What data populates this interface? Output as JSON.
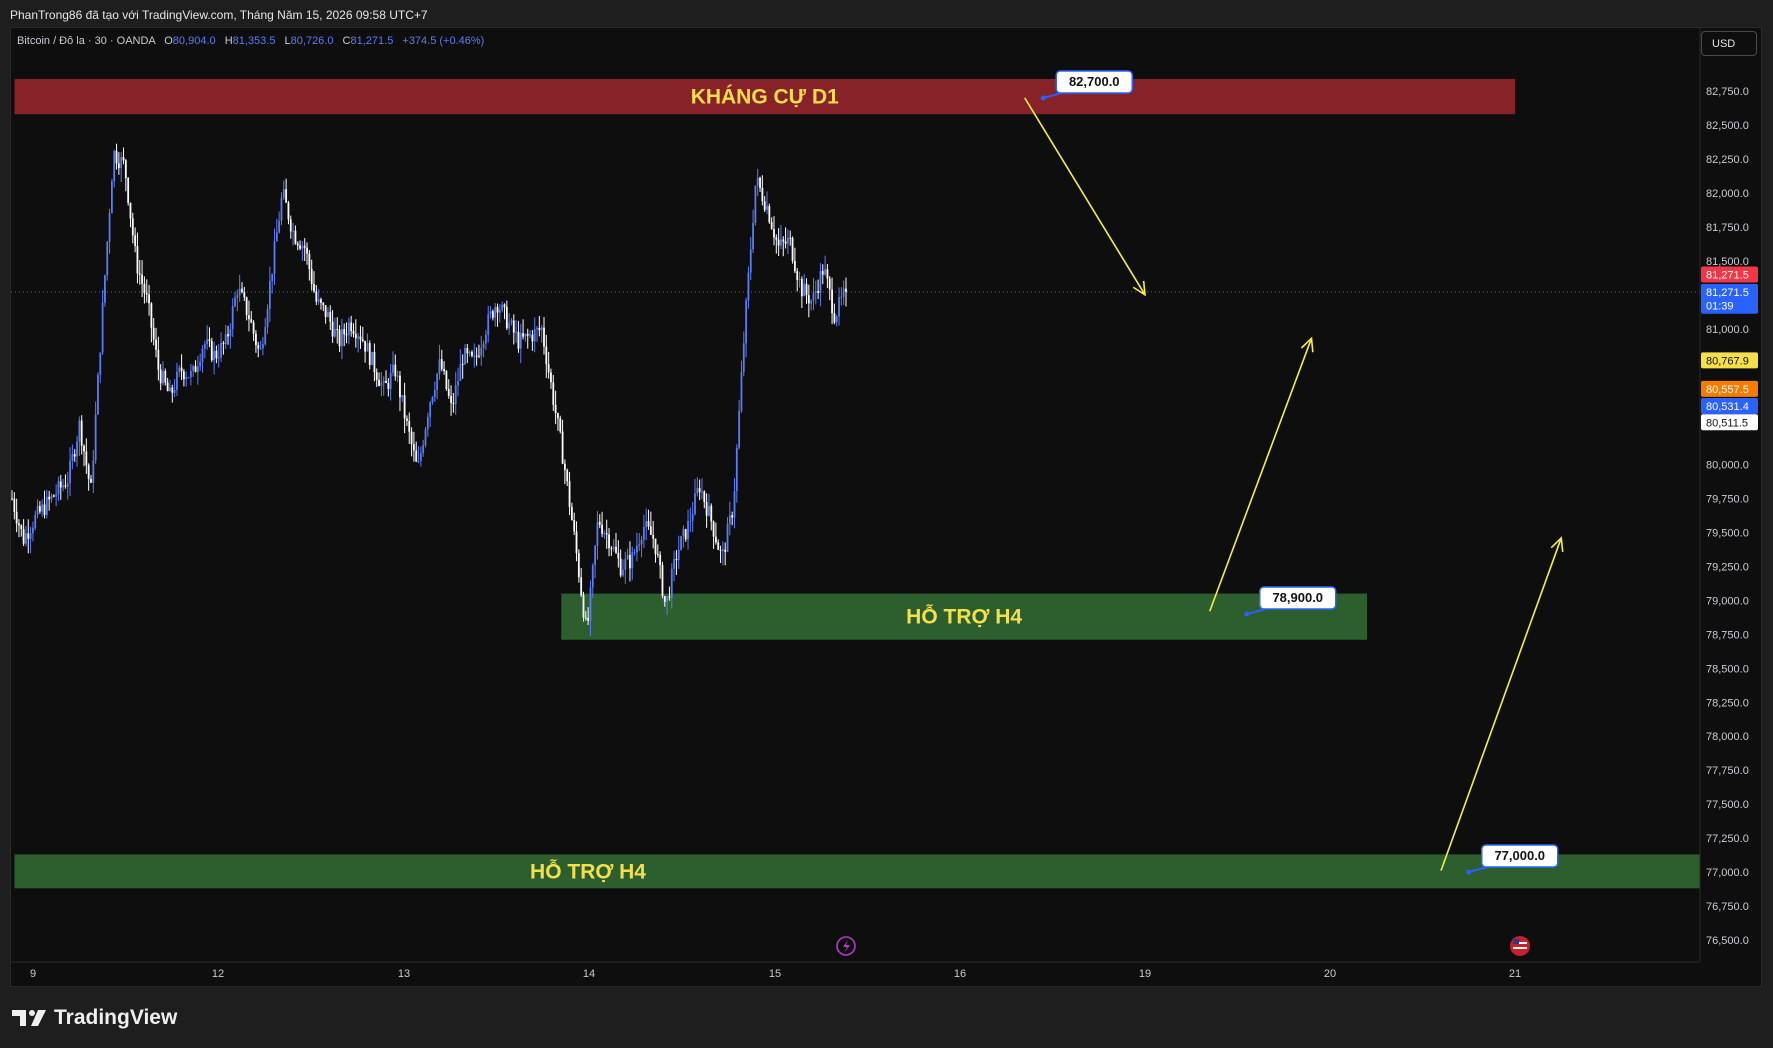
{
  "attribution": "PhanTrong86 đã tạo với TradingView.com, Tháng Năm 15, 2026 09:58 UTC+7",
  "legend": {
    "symbol": "Bitcoin / Đô la · 30 · OANDA",
    "o_label": "O",
    "o_value": "80,904.0",
    "h_label": "H",
    "h_value": "81,353.5",
    "l_label": "L",
    "l_value": "80,726.0",
    "c_label": "C",
    "c_value": "81,271.5",
    "change": "+374.5 (+0.46%)"
  },
  "currency_button": "USD",
  "logo_text": "TradingView",
  "colors": {
    "up": "#5b7cf7",
    "down": "#ffffff",
    "resistance": "#862228",
    "support": "#2c5e2e",
    "arrow": "#f4f047",
    "bg": "#0e0e0e"
  },
  "chart_data": {
    "type": "candlestick",
    "x_labels": [
      "9",
      "12",
      "13",
      "14",
      "15",
      "16",
      "19",
      "20",
      "21"
    ],
    "y_ticks": [
      "82,750.0",
      "82,500.0",
      "82,250.0",
      "82,000.0",
      "81,750.0",
      "81,500.0",
      "81,000.0",
      "80,000.0",
      "79,750.0",
      "79,500.0",
      "79,250.0",
      "79,000.0",
      "78,750.0",
      "78,500.0",
      "78,250.0",
      "78,000.0",
      "77,750.0",
      "77,500.0",
      "77,250.0",
      "77,000.0",
      "76,750.0",
      "76,500.0"
    ],
    "ylim": [
      76350,
      83250
    ],
    "price_tags": [
      {
        "text": "81,271.5",
        "price": 81400,
        "bg": "#f23645",
        "fg": "#ffffff"
      },
      {
        "text": "81,271.5",
        "price": 81271.5,
        "bg": "#2962ff",
        "fg": "#ffffff"
      },
      {
        "text": "01:39",
        "price": 81170,
        "bg": "#2962ff",
        "fg": "#ffffff"
      },
      {
        "text": "80,767.9",
        "price": 80767.9,
        "bg": "#f5e04a",
        "fg": "#111111"
      },
      {
        "text": "80,557.5",
        "price": 80557.5,
        "bg": "#f57c00",
        "fg": "#ffffff"
      },
      {
        "text": "80,531.4",
        "price": 80431.4,
        "bg": "#2962ff",
        "fg": "#ffffff"
      },
      {
        "text": "80,511.5",
        "price": 80311.5,
        "bg": "#ffffff",
        "fg": "#111111"
      }
    ],
    "zones": [
      {
        "label": "KHÁNG CỰ D1",
        "top": 82840,
        "bottom": 82580,
        "x_start_day": 8.9,
        "x_end_day": 21,
        "color": "#862228"
      },
      {
        "label": "HỖ TRỢ H4",
        "top": 79050,
        "bottom": 78710,
        "x_start_day": 13.85,
        "x_end_day": 20.2,
        "color": "#2c5e2e"
      },
      {
        "label": "HỖ TRỢ H4",
        "top": 77130,
        "bottom": 76880,
        "x_start_day": 8.9,
        "x_end_day": 22,
        "color": "#2c5e2e"
      }
    ],
    "callouts": [
      {
        "text": "82,700.0",
        "day": 16.45,
        "price": 82700
      },
      {
        "text": "78,900.0",
        "day": 19.55,
        "price": 78900
      },
      {
        "text": "77,000.0",
        "day": 20.75,
        "price": 77000
      }
    ],
    "arrows": [
      {
        "from": [
          16.35,
          82700
        ],
        "to": [
          18.85,
          81250
        ]
      },
      {
        "from": [
          19.35,
          78920
        ],
        "to": [
          19.9,
          80930
        ]
      },
      {
        "from": [
          20.6,
          77010
        ],
        "to": [
          21.25,
          79460
        ]
      }
    ],
    "current_price": 81271.5,
    "series_anchor_prices": [
      79750,
      79450,
      79600,
      79700,
      79800,
      79900,
      80300,
      79800,
      81100,
      82300,
      82200,
      81500,
      81200,
      80700,
      80500,
      80700,
      80650,
      80900,
      80800,
      80900,
      81300,
      81100,
      80800,
      81400,
      82000,
      81700,
      81600,
      81200,
      81100,
      80900,
      81050,
      80950,
      80750,
      80550,
      80700,
      80300,
      79950,
      80450,
      80750,
      80400,
      80800,
      80750,
      81000,
      81200,
      81050,
      80900,
      80950,
      81000,
      80500,
      80000,
      79400,
      78750,
      79600,
      79450,
      79250,
      79300,
      79550,
      79450,
      78950,
      79350,
      79550,
      79850,
      79600,
      79300,
      79700,
      81000,
      82100,
      81900,
      81600,
      81650,
      81300,
      81200,
      81450,
      81100,
      81271.5
    ]
  }
}
